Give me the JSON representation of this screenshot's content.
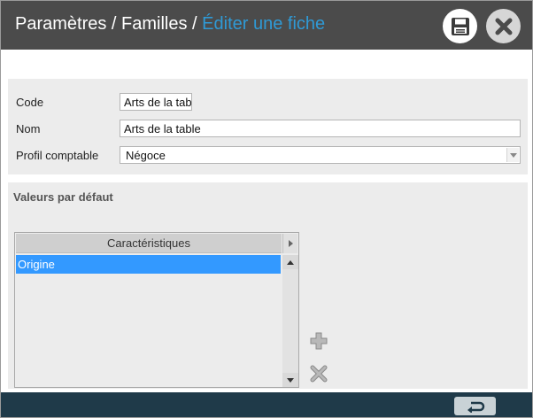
{
  "header": {
    "breadcrumb_1": "Paramètres",
    "separator_1": " / ",
    "breadcrumb_2": "Familles",
    "separator_2": " / ",
    "current": "Éditer une fiche",
    "save_icon": "floppy-disk-icon",
    "close_icon": "close-x-icon"
  },
  "form": {
    "code_label": "Code",
    "code_value": "Arts de la tab",
    "name_label": "Nom",
    "name_value": "Arts de la table",
    "profile_label": "Profil comptable",
    "profile_value": "Négoce"
  },
  "defaults": {
    "title": "Valeurs par défaut",
    "grid": {
      "column_header": "Caractéristiques",
      "rows": [
        "Origine"
      ]
    }
  },
  "colors": {
    "header_bg": "#4b4b4b",
    "accent": "#2f9ad6",
    "selection": "#3399ff",
    "footer_bg": "#1f3a49"
  }
}
